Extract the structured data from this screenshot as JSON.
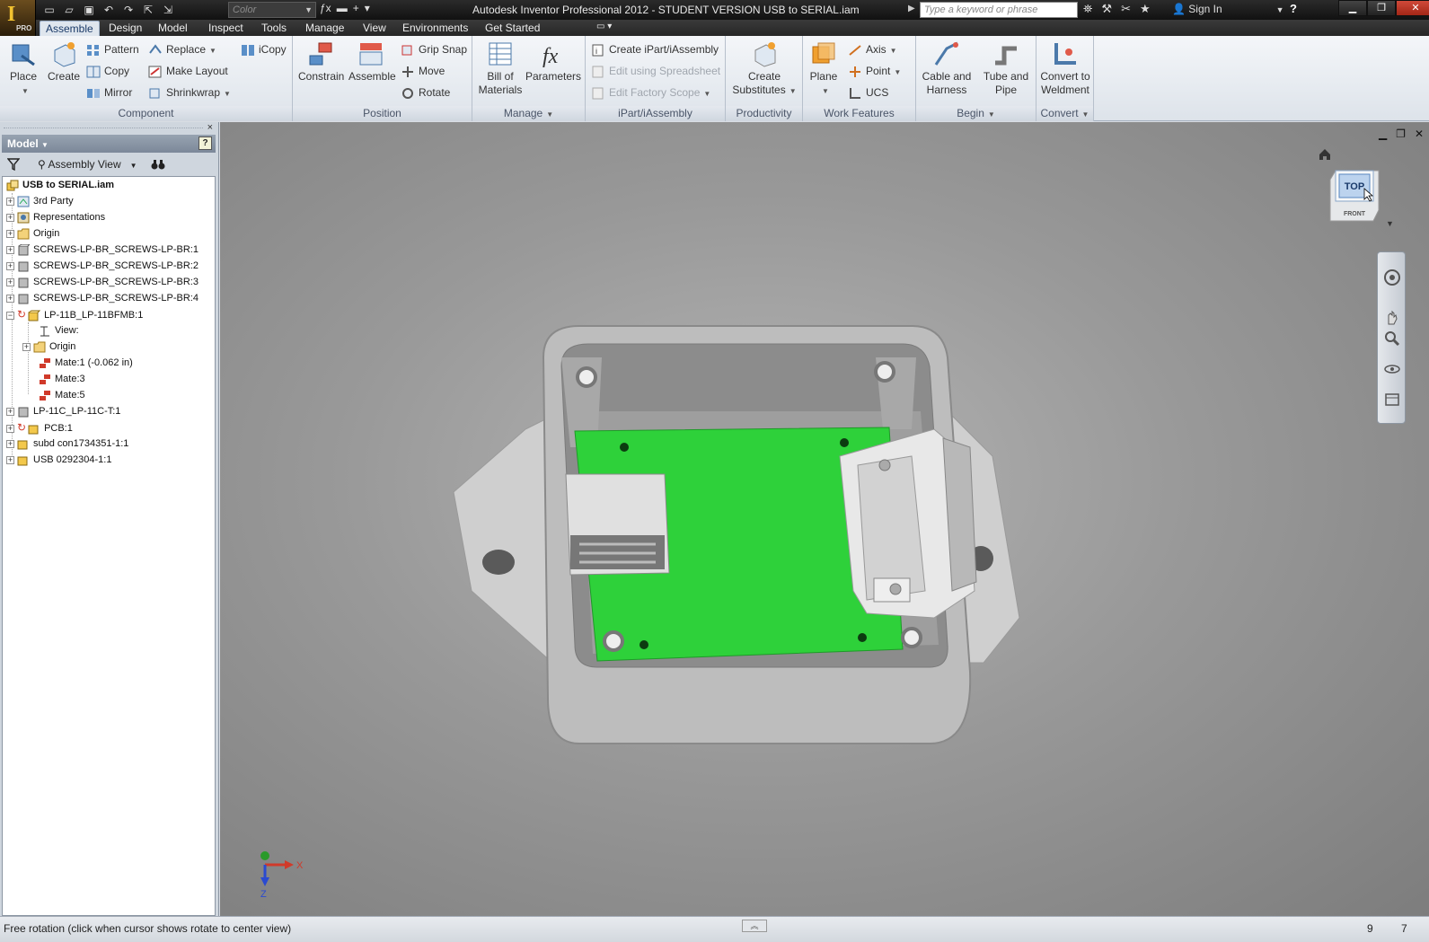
{
  "window": {
    "title": "Autodesk Inventor Professional 2012 - STUDENT VERSION    USB to SERIAL.iam",
    "app_badge": "PRO",
    "color_select": "Color",
    "search_placeholder": "Type a keyword or phrase",
    "sign_in": "Sign In",
    "help": "?"
  },
  "ribbon_tabs": [
    "Assemble",
    "Design",
    "Model",
    "Inspect",
    "Tools",
    "Manage",
    "View",
    "Environments",
    "Get Started"
  ],
  "ribbon": {
    "component": {
      "label": "Component",
      "place": "Place",
      "create": "Create",
      "pattern": "Pattern",
      "copy": "Copy",
      "mirror": "Mirror",
      "replace": "Replace",
      "make_layout": "Make Layout",
      "shrinkwrap": "Shrinkwrap",
      "icopy": "iCopy"
    },
    "position": {
      "label": "Position",
      "constrain": "Constrain",
      "assemble": "Assemble",
      "grip_snap": "Grip Snap",
      "move": "Move",
      "rotate": "Rotate"
    },
    "manage": {
      "label": "Manage",
      "bom_line1": "Bill of",
      "bom_line2": "Materials",
      "parameters": "Parameters"
    },
    "ipart": {
      "label": "iPart/iAssembly",
      "create": "Create iPart/iAssembly",
      "edit_spreadsheet": "Edit using Spreadsheet",
      "edit_scope": "Edit Factory Scope"
    },
    "productivity": {
      "label": "Productivity",
      "line1": "Create",
      "line2": "Substitutes"
    },
    "work_features": {
      "label": "Work Features",
      "plane": "Plane",
      "axis": "Axis",
      "point": "Point",
      "ucs": "UCS"
    },
    "begin": {
      "label": "Begin",
      "cable_line1": "Cable and",
      "cable_line2": "Harness",
      "tube_line1": "Tube and",
      "tube_line2": "Pipe"
    },
    "convert": {
      "label": "Convert",
      "line1": "Convert to",
      "line2": "Weldment"
    }
  },
  "browser": {
    "close": "×",
    "header": "Model",
    "help": "?",
    "view": "Assembly View",
    "tree": [
      {
        "label": "USB to SERIAL.iam",
        "icon": "assembly-root-icon"
      },
      {
        "label": "3rd Party",
        "icon": "third-party-icon"
      },
      {
        "label": "Representations",
        "icon": "representations-icon"
      },
      {
        "label": "Origin",
        "icon": "folder-icon"
      },
      {
        "label": "SCREWS-LP-BR_SCREWS-LP-BR:1",
        "icon": "part-icon"
      },
      {
        "label": "SCREWS-LP-BR_SCREWS-LP-BR:2",
        "icon": "part-icon"
      },
      {
        "label": "SCREWS-LP-BR_SCREWS-LP-BR:3",
        "icon": "part-icon"
      },
      {
        "label": "SCREWS-LP-BR_SCREWS-LP-BR:4",
        "icon": "part-icon"
      },
      {
        "label": "LP-11B_LP-11BFMB:1",
        "icon": "subassembly-icon"
      },
      {
        "label": "View:",
        "icon": "view-icon"
      },
      {
        "label": "Origin",
        "icon": "folder-icon"
      },
      {
        "label": "Mate:1 (-0.062 in)",
        "icon": "mate-icon"
      },
      {
        "label": "Mate:3",
        "icon": "mate-icon"
      },
      {
        "label": "Mate:5",
        "icon": "mate-icon"
      },
      {
        "label": "LP-11C_LP-11C-T:1",
        "icon": "part-icon"
      },
      {
        "label": "PCB:1",
        "icon": "subassembly-icon"
      },
      {
        "label": "subd con1734351-1:1",
        "icon": "subassembly-icon"
      },
      {
        "label": "USB 0292304-1:1",
        "icon": "subassembly-icon"
      }
    ]
  },
  "viewport": {
    "viewcube_top": "TOP",
    "viewcube_front": "FRONT",
    "triad_x": "X",
    "triad_z": "Z"
  },
  "status": {
    "text": "Free rotation (click when cursor shows rotate to center view)",
    "n1": "9",
    "n2": "7"
  },
  "colors": {
    "pcb_green": "#2ed13a",
    "housing_gray": "#c9c9c9",
    "titlebar": "#1a1a1a",
    "ribbon_bg": "#e8ecf1"
  }
}
